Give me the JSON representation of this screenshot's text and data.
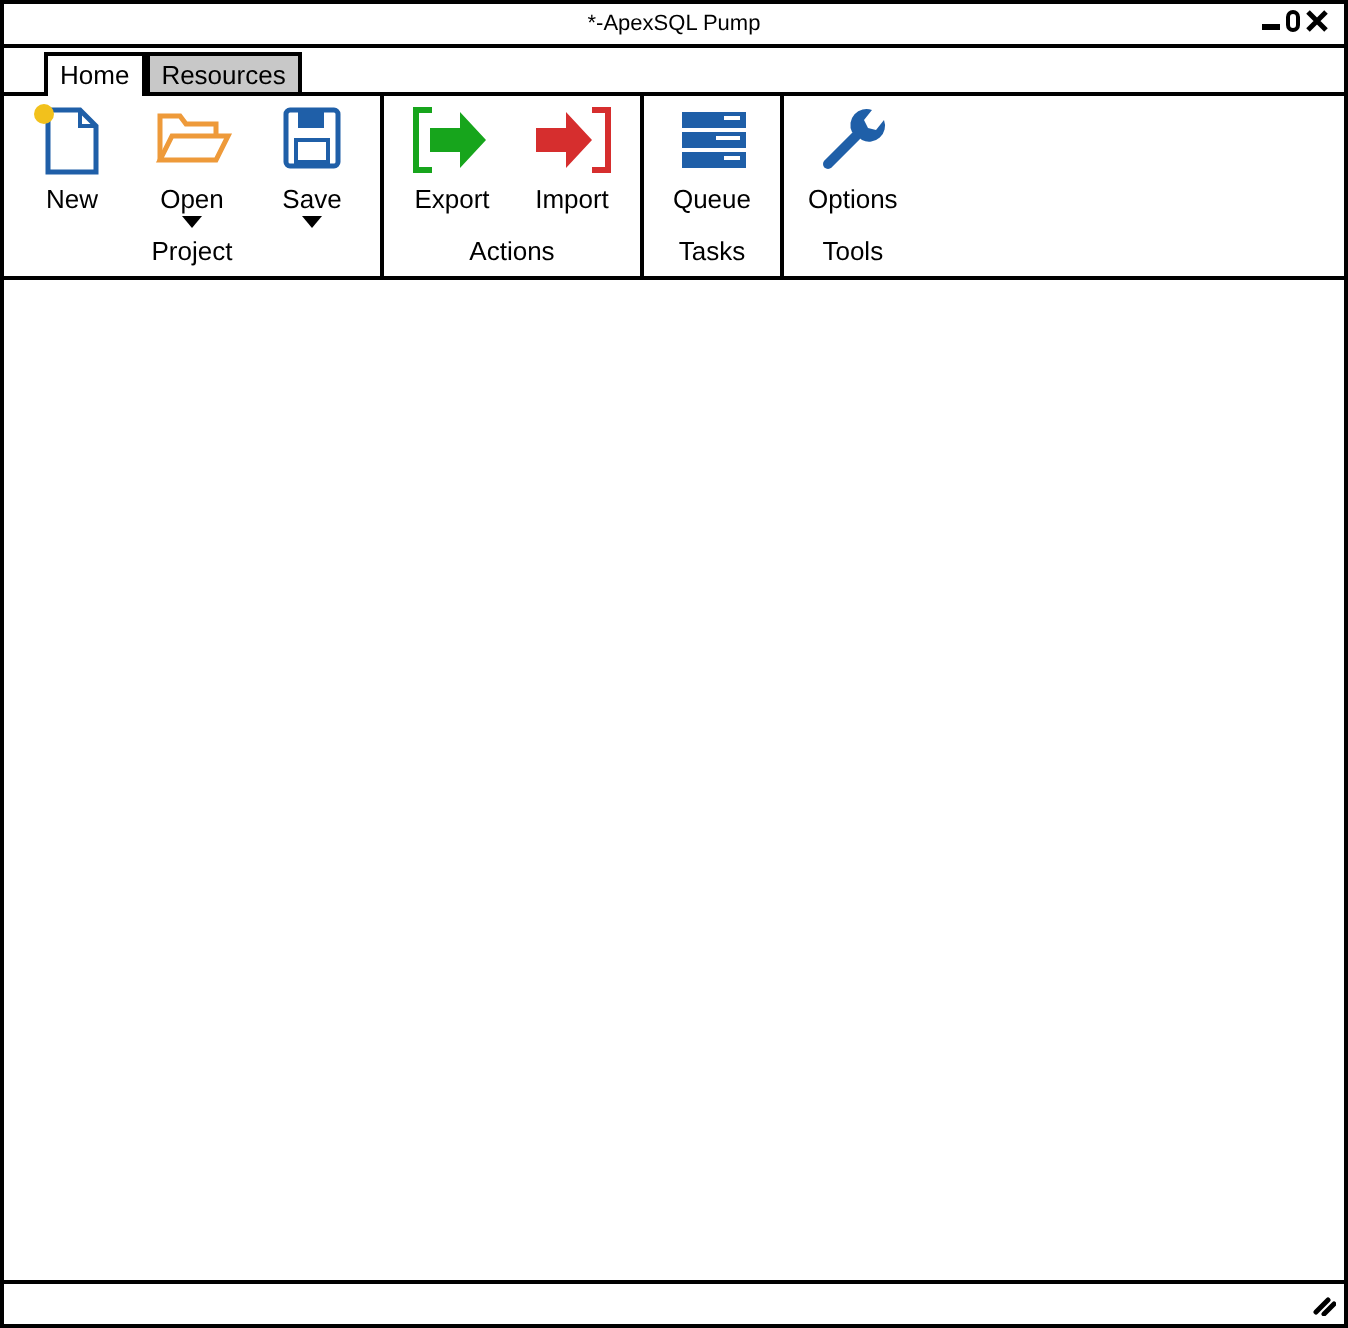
{
  "window": {
    "title": "*-ApexSQL Pump"
  },
  "tabs": [
    {
      "label": "Home",
      "selected": true
    },
    {
      "label": "Resources",
      "selected": false
    }
  ],
  "ribbon": {
    "groups": [
      {
        "label": "Project",
        "buttons": [
          {
            "label": "New",
            "kind": "new",
            "dropdown": false
          },
          {
            "label": "Open",
            "kind": "open",
            "dropdown": true
          },
          {
            "label": "Save",
            "kind": "save",
            "dropdown": true
          }
        ]
      },
      {
        "label": "Actions",
        "buttons": [
          {
            "label": "Export",
            "kind": "export",
            "dropdown": false
          },
          {
            "label": "Import",
            "kind": "import",
            "dropdown": false
          }
        ]
      },
      {
        "label": "Tasks",
        "buttons": [
          {
            "label": "Queue",
            "kind": "queue",
            "dropdown": false
          }
        ]
      },
      {
        "label": "Tools",
        "buttons": [
          {
            "label": "Options",
            "kind": "options",
            "dropdown": false
          }
        ]
      }
    ]
  }
}
